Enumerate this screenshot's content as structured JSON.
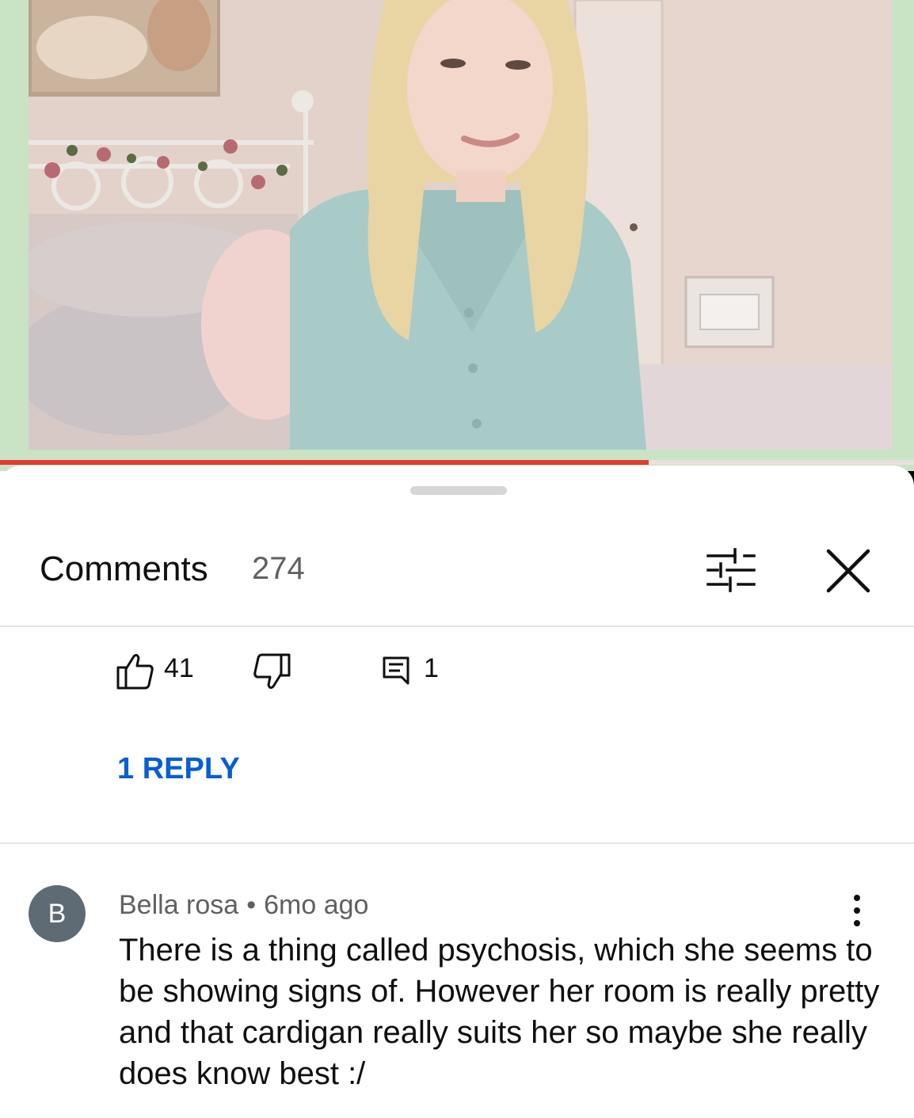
{
  "player": {
    "progress_fraction": 0.71
  },
  "comments_panel": {
    "title": "Comments",
    "count": "274",
    "filter_icon": "sliders-icon",
    "close_icon": "close-icon"
  },
  "previous_comment": {
    "like_count": "41",
    "reply_count": "1",
    "replies_link": "1 REPLY"
  },
  "comment": {
    "avatar_letter": "B",
    "author": "Bella rosa",
    "separator": "•",
    "time": "6mo ago",
    "text": "There is a thing called psychosis, which she seems to be showing signs of. However her room is really pretty and that cardigan really suits her so maybe she really does know best :/"
  },
  "colors": {
    "progress": "#e53a2f",
    "link": "#065fd4",
    "avatar": "#5f6b74",
    "frame": "#c9e3c5"
  }
}
